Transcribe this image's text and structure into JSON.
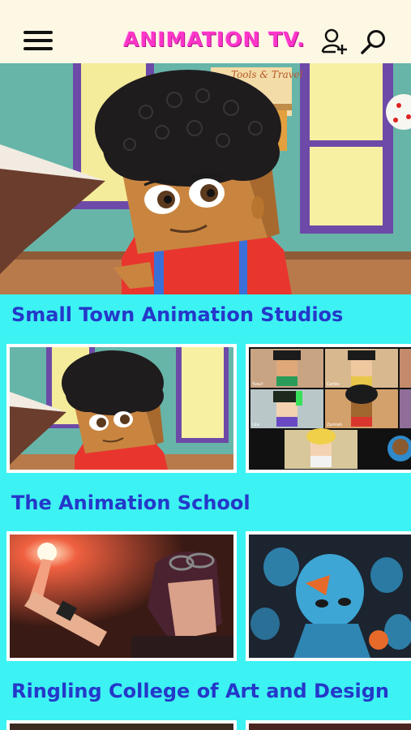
{
  "app": {
    "logo_text": "ANIMATION TV."
  },
  "icons": {
    "menu": "hamburger-icon",
    "account": "add-user-icon",
    "search": "search-icon"
  },
  "colors": {
    "header_bg": "#fdf8e4",
    "page_bg": "#3df2f2",
    "section_title": "#2438c9",
    "logo": "#ff35c8"
  },
  "hero": {
    "background_text": "Tools & Travel"
  },
  "sections": [
    {
      "title": "Small Town Animation Studios"
    },
    {
      "title": "The Animation School"
    },
    {
      "title": "Ringling College of Art and Design"
    }
  ],
  "video_call_names": [
    "Yusuf",
    "Carlos",
    "Lila",
    "Zamiah"
  ]
}
